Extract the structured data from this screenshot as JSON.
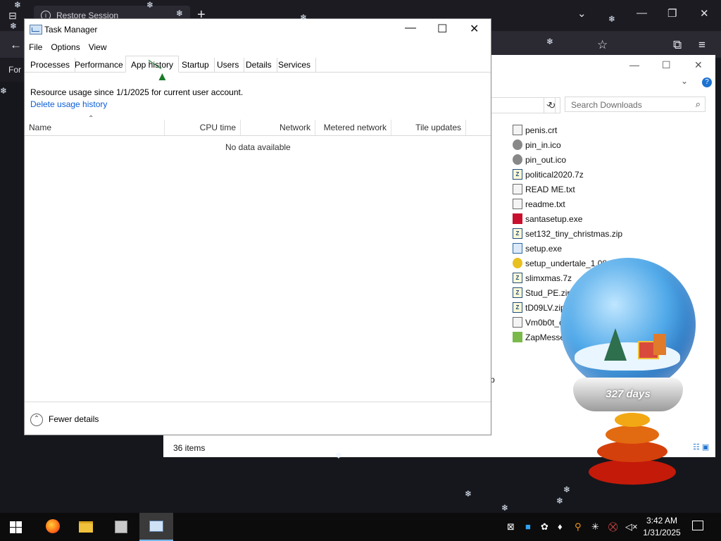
{
  "browser": {
    "tab_title": "Restore Session",
    "bookmark_partial": "For"
  },
  "explorer": {
    "search_placeholder": "Search Downloads",
    "files": [
      {
        "name": "penis.crt",
        "icon": "certificate-icon",
        "kind": "doc"
      },
      {
        "name": "pin_in.ico",
        "icon": "ico-file-icon",
        "kind": "ico"
      },
      {
        "name": "pin_out.ico",
        "icon": "ico-file-icon",
        "kind": "ico"
      },
      {
        "name": "political2020.7z",
        "icon": "archive-icon",
        "kind": "zip"
      },
      {
        "name": "READ ME.txt",
        "icon": "text-file-icon",
        "kind": "doc"
      },
      {
        "name": "readme.txt",
        "icon": "text-file-icon",
        "kind": "doc"
      },
      {
        "name": "santasetup.exe",
        "icon": "santa-app-icon",
        "kind": "santa"
      },
      {
        "name": "set132_tiny_christmas.zip",
        "icon": "archive-icon",
        "kind": "zip"
      },
      {
        "name": "setup.exe",
        "icon": "installer-icon",
        "kind": "exe"
      },
      {
        "name": "setup_undertale_1.08_(193",
        "icon": "gear-app-icon",
        "kind": "gear"
      },
      {
        "name": "slimxmas.7z",
        "icon": "archive-icon",
        "kind": "zip"
      },
      {
        "name": "Stud_PE.zip",
        "icon": "archive-icon",
        "kind": "zip"
      },
      {
        "name": "tD09LV.zip",
        "icon": "archive-icon",
        "kind": "zip"
      },
      {
        "name": "Vm0b0t_c",
        "icon": "text-file-icon",
        "kind": "doc"
      },
      {
        "name": "ZapMesse",
        "icon": "zap-app-icon",
        "kind": "zap"
      }
    ],
    "partial_text": "p",
    "status_count": "36 items"
  },
  "task_manager": {
    "title": "Task Manager",
    "menu": [
      "File",
      "Options",
      "View"
    ],
    "tabs": [
      "Processes",
      "Performance",
      "App history",
      "Startup",
      "Users",
      "Details",
      "Services"
    ],
    "active_tab": "App history",
    "resource_text": "Resource usage since 1/1/2025 for current user account.",
    "delete_link": "Delete usage history",
    "columns": [
      "Name",
      "CPU time",
      "Network",
      "Metered network",
      "Tile updates"
    ],
    "empty_text": "No data available",
    "fewer_details": "Fewer details"
  },
  "globe": {
    "days_label": "327 days"
  },
  "taskbar": {
    "time": "3:42 AM",
    "date": "1/31/2025"
  }
}
